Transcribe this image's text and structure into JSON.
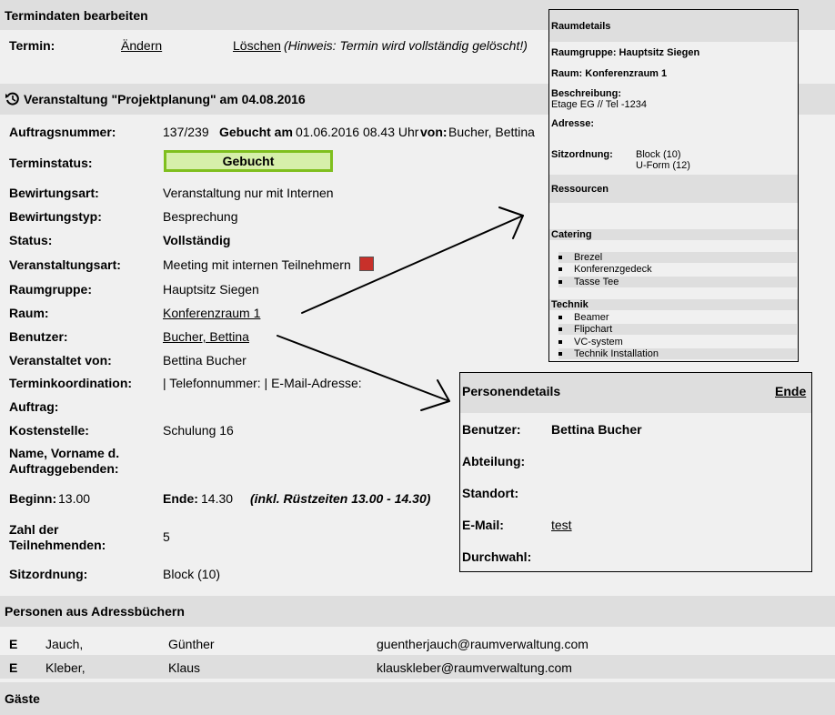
{
  "header": {
    "title": "Termindaten bearbeiten"
  },
  "termin": {
    "label": "Termin:",
    "change_link": "Ändern",
    "delete_link": "Löschen",
    "hint": "(Hinweis: Termin wird vollständig gelöscht!)"
  },
  "event": {
    "title": "Veranstaltung \"Projektplanung\" am 04.08.2016"
  },
  "fields": {
    "auftragsnummer_label": "Auftragsnummer:",
    "auftragsnummer_value": "137/239",
    "gebucht_label": "Gebucht am",
    "gebucht_value": "01.06.2016 08.43 Uhr",
    "von_label": "von:",
    "von_value": "Bucher, Bettina",
    "terminstatus_label": "Terminstatus:",
    "terminstatus_value": "Gebucht",
    "bewirtungsart_label": "Bewirtungsart:",
    "bewirtungsart_value": "Veranstaltung nur mit Internen",
    "bewirtungstyp_label": "Bewirtungstyp:",
    "bewirtungstyp_value": "Besprechung",
    "status_label": "Status:",
    "status_value": "Vollständig",
    "veranstaltungsart_label": "Veranstaltungsart:",
    "veranstaltungsart_value": "Meeting mit internen Teilnehmern",
    "raumgruppe_label": "Raumgruppe:",
    "raumgruppe_value": "Hauptsitz Siegen",
    "raum_label": "Raum:",
    "raum_value": "Konferenzraum 1",
    "benutzer_label": "Benutzer:",
    "benutzer_value": "Bucher, Bettina",
    "veranstaltet_label": "Veranstaltet von:",
    "veranstaltet_value": "Bettina Bucher",
    "terminkoordination_label": "Terminkoordination:",
    "terminkoordination_value": "| Telefonnummer: | E-Mail-Adresse:",
    "auftrag_label": "Auftrag:",
    "kostenstelle_label": "Kostenstelle:",
    "kostenstelle_value": "Schulung 16",
    "name_label_1": "Name, Vorname d.",
    "name_label_2": "Auftraggebenden:",
    "beginn_label": "Beginn:",
    "beginn_value": "13.00",
    "ende_label": "Ende:",
    "ende_value": "14.30",
    "ruest_value": "(inkl. Rüstzeiten 13.00 - 14.30)",
    "zahl_label_1": "Zahl der",
    "zahl_label_2": "Teilnehmenden:",
    "zahl_value": "5",
    "sitz_label": "Sitzordnung:",
    "sitz_value": "Block (10)"
  },
  "addressbook": {
    "title": "Personen aus Adressbüchern",
    "rows": [
      {
        "type": "E",
        "last": "Jauch,",
        "first": "Günther",
        "email": "guentherjauch@raumverwaltung.com"
      },
      {
        "type": "E",
        "last": "Kleber,",
        "first": "Klaus",
        "email": "klauskleber@raumverwaltung.com"
      }
    ]
  },
  "guests": {
    "title": "Gäste"
  },
  "raumdetails": {
    "title": "Raumdetails",
    "raumgruppe": "Raumgruppe: Hauptsitz Siegen",
    "raum": "Raum: Konferenzraum 1",
    "beschreibung_label": "Beschreibung:",
    "beschreibung_value": "Etage EG // Tel -1234",
    "adresse_label": "Adresse:",
    "sitz_label": "Sitzordnung:",
    "sitz_value_1": "Block (10)",
    "sitz_value_2": "U-Form (12)",
    "ressourcen_title": "Ressourcen",
    "catering_title": "Catering",
    "catering_items": [
      "Brezel",
      "Konferenzgedeck",
      "Tasse Tee"
    ],
    "technik_title": "Technik",
    "technik_items": [
      "Beamer",
      "Flipchart",
      "VC-system",
      "Technik Installation"
    ]
  },
  "personendetails": {
    "title": "Personendetails",
    "close_link": "Ende",
    "benutzer_label": "Benutzer:",
    "benutzer_value": "Bettina Bucher",
    "abteilung_label": "Abteilung:",
    "standort_label": "Standort:",
    "email_label": "E-Mail:",
    "email_value": "test",
    "durchwahl_label": "Durchwahl:"
  },
  "colors": {
    "status_fill": "#d6efaa",
    "status_border": "#7fbf1e",
    "event_type_marker": "#c8302a",
    "section_band": "#dedede"
  }
}
